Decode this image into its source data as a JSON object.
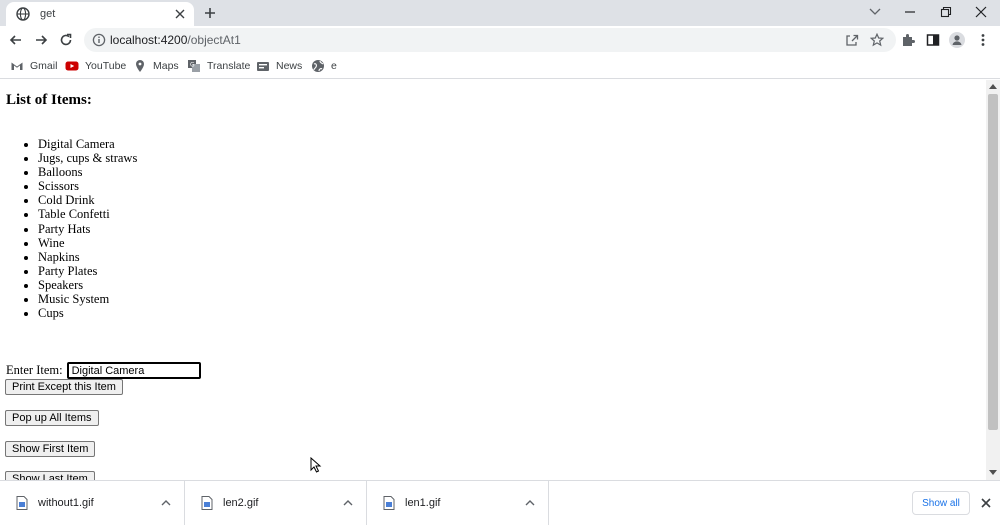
{
  "browser": {
    "tab": {
      "title": "get",
      "favicon": "globe-icon"
    },
    "address": {
      "host": "localhost:4200",
      "path": "/objectAt1"
    },
    "bookmarks": [
      {
        "label": "Gmail",
        "icon": "gmail-icon"
      },
      {
        "label": "YouTube",
        "icon": "youtube-icon"
      },
      {
        "label": "Maps",
        "icon": "maps-icon"
      },
      {
        "label": "Translate",
        "icon": "translate-icon"
      },
      {
        "label": "News",
        "icon": "news-icon"
      },
      {
        "label": "e",
        "icon": "globe-icon"
      }
    ]
  },
  "page": {
    "heading": "List of Items:",
    "items": [
      "Digital Camera",
      "Jugs, cups & straws",
      "Balloons",
      "Scissors",
      "Cold Drink",
      "Table Confetti",
      "Party Hats",
      "Wine",
      "Napkins",
      "Party Plates",
      "Speakers",
      "Music System",
      "Cups"
    ],
    "enter_label": "Enter Item:",
    "enter_value": "Digital Camera",
    "buttons": {
      "print_except": "Print Except this Item",
      "pop_up_all": "Pop up All Items",
      "show_first": "Show First Item",
      "show_last": "Show Last Item"
    }
  },
  "downloads": {
    "files": [
      "without1.gif",
      "len2.gif",
      "len1.gif"
    ],
    "show_all": "Show all"
  },
  "colors": {
    "tabstrip_bg": "#dee1e6",
    "omnibox_bg": "#f1f3f4",
    "link_blue": "#1a73e8",
    "youtube_red": "#ff0000"
  }
}
